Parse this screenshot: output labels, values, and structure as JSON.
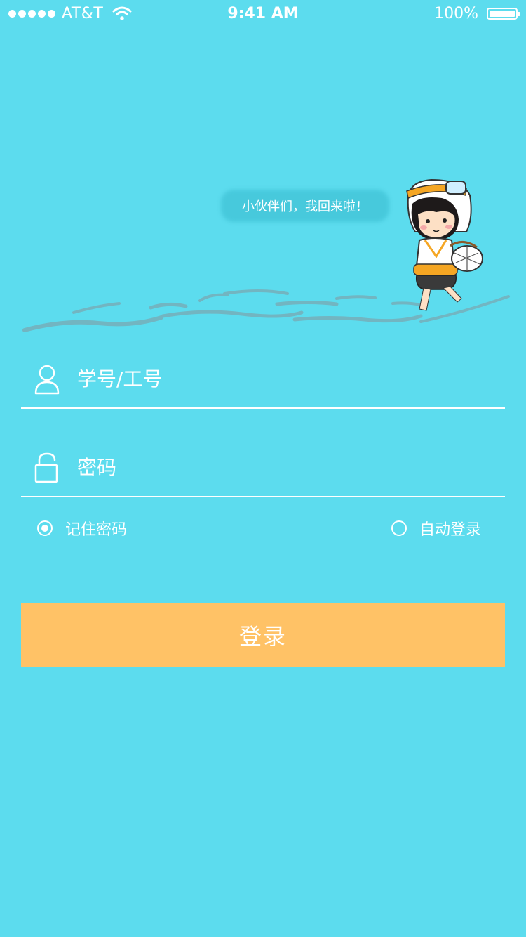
{
  "status_bar": {
    "carrier": "AT&T",
    "time": "9:41 AM",
    "battery": "100%"
  },
  "banner": {
    "speech": "小伙伴们，我回来啦！"
  },
  "form": {
    "username": {
      "placeholder": "学号/工号",
      "value": ""
    },
    "password": {
      "placeholder": "密码",
      "value": ""
    },
    "remember": {
      "label": "记住密码",
      "checked": true
    },
    "auto_login": {
      "label": "自动登录",
      "checked": false
    },
    "submit_label": "登录"
  },
  "icons": {
    "username": "user-icon",
    "password": "unlock-icon"
  },
  "colors": {
    "background": "#5cdcee",
    "button": "#ffc266",
    "text": "#ffffff"
  }
}
